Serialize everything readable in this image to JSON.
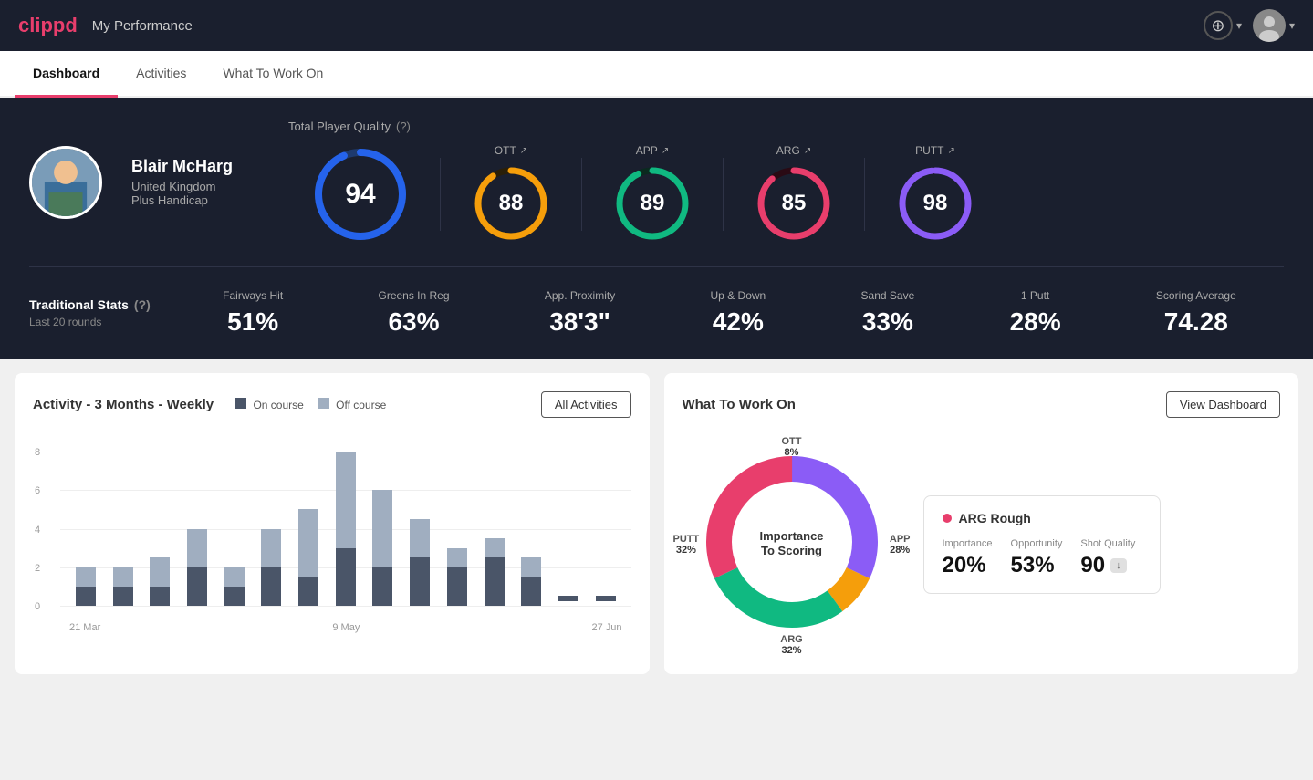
{
  "header": {
    "logo": "clippd",
    "title": "My Performance",
    "add_label": "+",
    "chevron": "▾"
  },
  "tabs": [
    {
      "id": "dashboard",
      "label": "Dashboard",
      "active": true
    },
    {
      "id": "activities",
      "label": "Activities",
      "active": false
    },
    {
      "id": "what-to-work-on",
      "label": "What To Work On",
      "active": false
    }
  ],
  "player": {
    "name": "Blair McHarg",
    "country": "United Kingdom",
    "handicap": "Plus Handicap"
  },
  "quality": {
    "label": "Total Player Quality",
    "main": {
      "value": "94",
      "color": "#2563eb"
    },
    "metrics": [
      {
        "id": "ott",
        "label": "OTT",
        "value": "88",
        "color": "#f59e0b"
      },
      {
        "id": "app",
        "label": "APP",
        "value": "89",
        "color": "#10b981"
      },
      {
        "id": "arg",
        "label": "ARG",
        "value": "85",
        "color": "#e83e6c"
      },
      {
        "id": "putt",
        "label": "PUTT",
        "value": "98",
        "color": "#8b5cf6"
      }
    ]
  },
  "traditional_stats": {
    "label": "Traditional Stats",
    "sublabel": "Last 20 rounds",
    "items": [
      {
        "name": "Fairways Hit",
        "value": "51%"
      },
      {
        "name": "Greens In Reg",
        "value": "63%"
      },
      {
        "name": "App. Proximity",
        "value": "38'3\""
      },
      {
        "name": "Up & Down",
        "value": "42%"
      },
      {
        "name": "Sand Save",
        "value": "33%"
      },
      {
        "name": "1 Putt",
        "value": "28%"
      },
      {
        "name": "Scoring Average",
        "value": "74.28"
      }
    ]
  },
  "activity_chart": {
    "title": "Activity - 3 Months - Weekly",
    "legend": {
      "on_course": "On course",
      "off_course": "Off course"
    },
    "all_activities_btn": "All Activities",
    "y_labels": [
      "8",
      "6",
      "4",
      "2",
      "0"
    ],
    "x_labels": [
      "21 Mar",
      "9 May",
      "27 Jun"
    ],
    "bars": [
      {
        "on": 1,
        "off": 1
      },
      {
        "on": 1,
        "off": 1
      },
      {
        "on": 1,
        "off": 1.5
      },
      {
        "on": 2,
        "off": 2
      },
      {
        "on": 1,
        "off": 1
      },
      {
        "on": 2,
        "off": 2
      },
      {
        "on": 1.5,
        "off": 3.5
      },
      {
        "on": 3,
        "off": 5
      },
      {
        "on": 2,
        "off": 4
      },
      {
        "on": 2.5,
        "off": 2
      },
      {
        "on": 2,
        "off": 1
      },
      {
        "on": 2.5,
        "off": 1
      },
      {
        "on": 1.5,
        "off": 1
      },
      {
        "on": 0.5,
        "off": 0
      },
      {
        "on": 0.5,
        "off": 0
      }
    ]
  },
  "what_to_work_on": {
    "title": "What To Work On",
    "view_dashboard_btn": "View Dashboard",
    "donut_center_line1": "Importance",
    "donut_center_line2": "To Scoring",
    "segments": [
      {
        "id": "ott",
        "label": "OTT",
        "pct": "8%",
        "value": 8,
        "color": "#f59e0b"
      },
      {
        "id": "app",
        "label": "APP",
        "pct": "28%",
        "value": 28,
        "color": "#10b981"
      },
      {
        "id": "arg",
        "label": "ARG",
        "pct": "32%",
        "value": 32,
        "color": "#e83e6c"
      },
      {
        "id": "putt",
        "label": "PUTT",
        "pct": "32%",
        "value": 32,
        "color": "#8b5cf6"
      }
    ],
    "info_box": {
      "title": "ARG Rough",
      "dot_color": "#e83e6c",
      "metrics": [
        {
          "label": "Importance",
          "value": "20%"
        },
        {
          "label": "Opportunity",
          "value": "53%"
        },
        {
          "label": "Shot Quality",
          "value": "90",
          "badge": "↓"
        }
      ]
    }
  }
}
